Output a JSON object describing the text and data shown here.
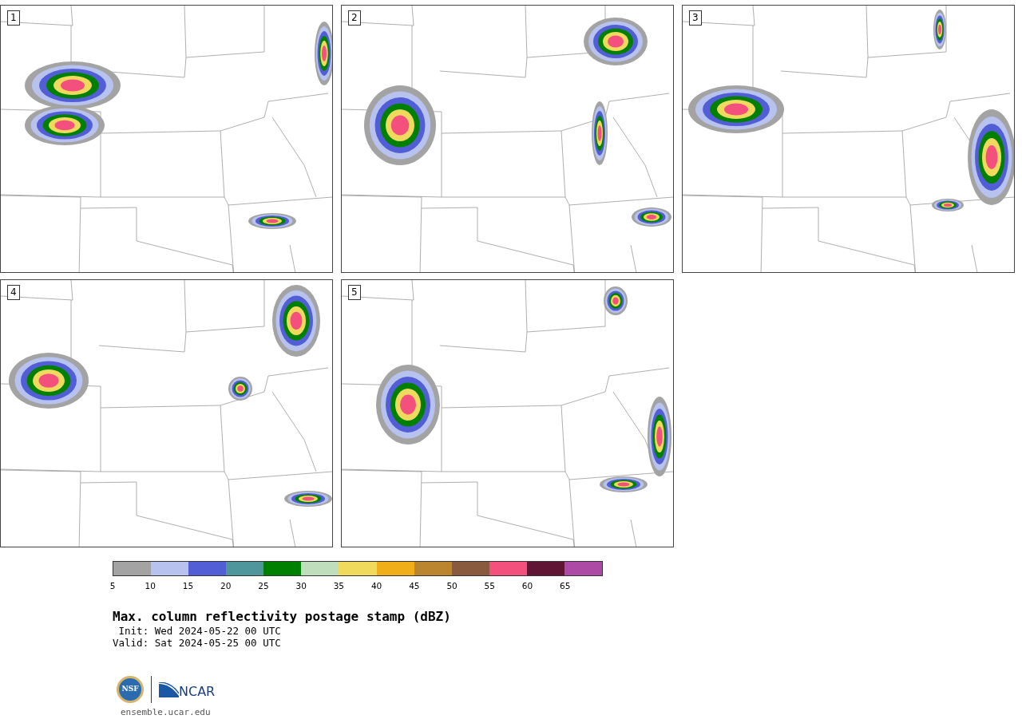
{
  "panels": [
    {
      "number": "1"
    },
    {
      "number": "2"
    },
    {
      "number": "3"
    },
    {
      "number": "4"
    },
    {
      "number": "5"
    }
  ],
  "colorbar": {
    "bins": [
      {
        "color": "#a3a3a3"
      },
      {
        "color": "#b7c2ee"
      },
      {
        "color": "#525ed6"
      },
      {
        "color": "#4e969b"
      },
      {
        "color": "#008000"
      },
      {
        "color": "#bedebc"
      },
      {
        "color": "#f0da5e"
      },
      {
        "color": "#f0ae18"
      },
      {
        "color": "#bb8530"
      },
      {
        "color": "#8a5a3e"
      },
      {
        "color": "#f4507e"
      },
      {
        "color": "#611535"
      },
      {
        "color": "#ad4aa6"
      }
    ],
    "ticks": [
      "5",
      "10",
      "15",
      "20",
      "25",
      "30",
      "35",
      "40",
      "45",
      "50",
      "55",
      "60",
      "65"
    ]
  },
  "title": "Max. column reflectivity postage stamp (dBZ)",
  "init": " Init: Wed 2024-05-22 00 UTC",
  "valid": "Valid: Sat 2024-05-25 00 UTC",
  "logos": {
    "nsf": "NSF",
    "ncar": "NCAR"
  },
  "url": "ensemble.ucar.edu"
}
